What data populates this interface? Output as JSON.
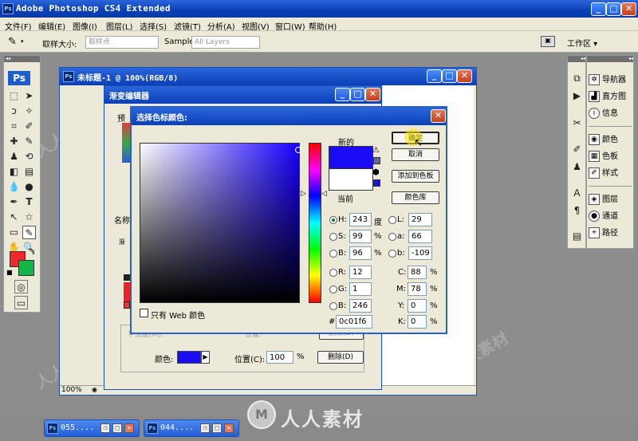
{
  "app": {
    "title": "Adobe Photoshop CS4 Extended"
  },
  "menu": [
    "文件(F)",
    "编辑(E)",
    "图像(I)",
    "图层(L)",
    "选择(S)",
    "滤镜(T)",
    "分析(A)",
    "视图(V)",
    "窗口(W)",
    "帮助(H)"
  ],
  "options": {
    "sample_size_label": "取样大小:",
    "sample_size_value": "取样点",
    "sample_label": "Sample:",
    "sample_value": "All Layers",
    "workspace": "工作区 ▾"
  },
  "doc": {
    "title": "未标题-1 @ 100%(RGB/8)",
    "zoom": "100%"
  },
  "gradient_editor": {
    "title": "渐变编辑器",
    "preset_label": "预",
    "name_label": "名称",
    "smooth_label": "平滑度(M):",
    "location_label": "位置:",
    "delete_label": "删除(D)",
    "color_label": "颜色:",
    "position_label": "位置(C):",
    "position_value": "100",
    "percent": "%",
    "delete_button": "删除(D)"
  },
  "picker": {
    "title": "选择色标颜色:",
    "new_label": "新的",
    "current_label": "当前",
    "ok": "确定",
    "cancel": "取消",
    "add_swatch": "添加到色板",
    "color_libraries": "颜色库",
    "web_only": "只有 Web 颜色",
    "new_color": "#1a0cf4",
    "current_color": "#ffffff",
    "hue_color": "#1800ff",
    "hsb": {
      "H": "243",
      "H_unit": "度",
      "S": "99",
      "S_unit": "%",
      "B": "96",
      "B_unit": "%"
    },
    "rgb": {
      "R": "12",
      "G": "1",
      "B": "246"
    },
    "lab": {
      "L": "29",
      "a": "66",
      "b": "-109"
    },
    "cmyk": {
      "C": "88",
      "M": "78",
      "Y": "0",
      "K": "0",
      "unit": "%"
    },
    "hex": "0c01f6",
    "hex_label": "#"
  },
  "panels": {
    "group1": [
      "导航器",
      "直方图",
      "信息"
    ],
    "group2": [
      "颜色",
      "色板",
      "样式"
    ],
    "group3": [
      "图层",
      "通道",
      "路径"
    ]
  },
  "taskbar": [
    {
      "label": "055...."
    },
    {
      "label": "044...."
    }
  ],
  "watermark": "人人素材",
  "colors": {
    "foreground": "#f0282d",
    "background": "#13b548"
  }
}
